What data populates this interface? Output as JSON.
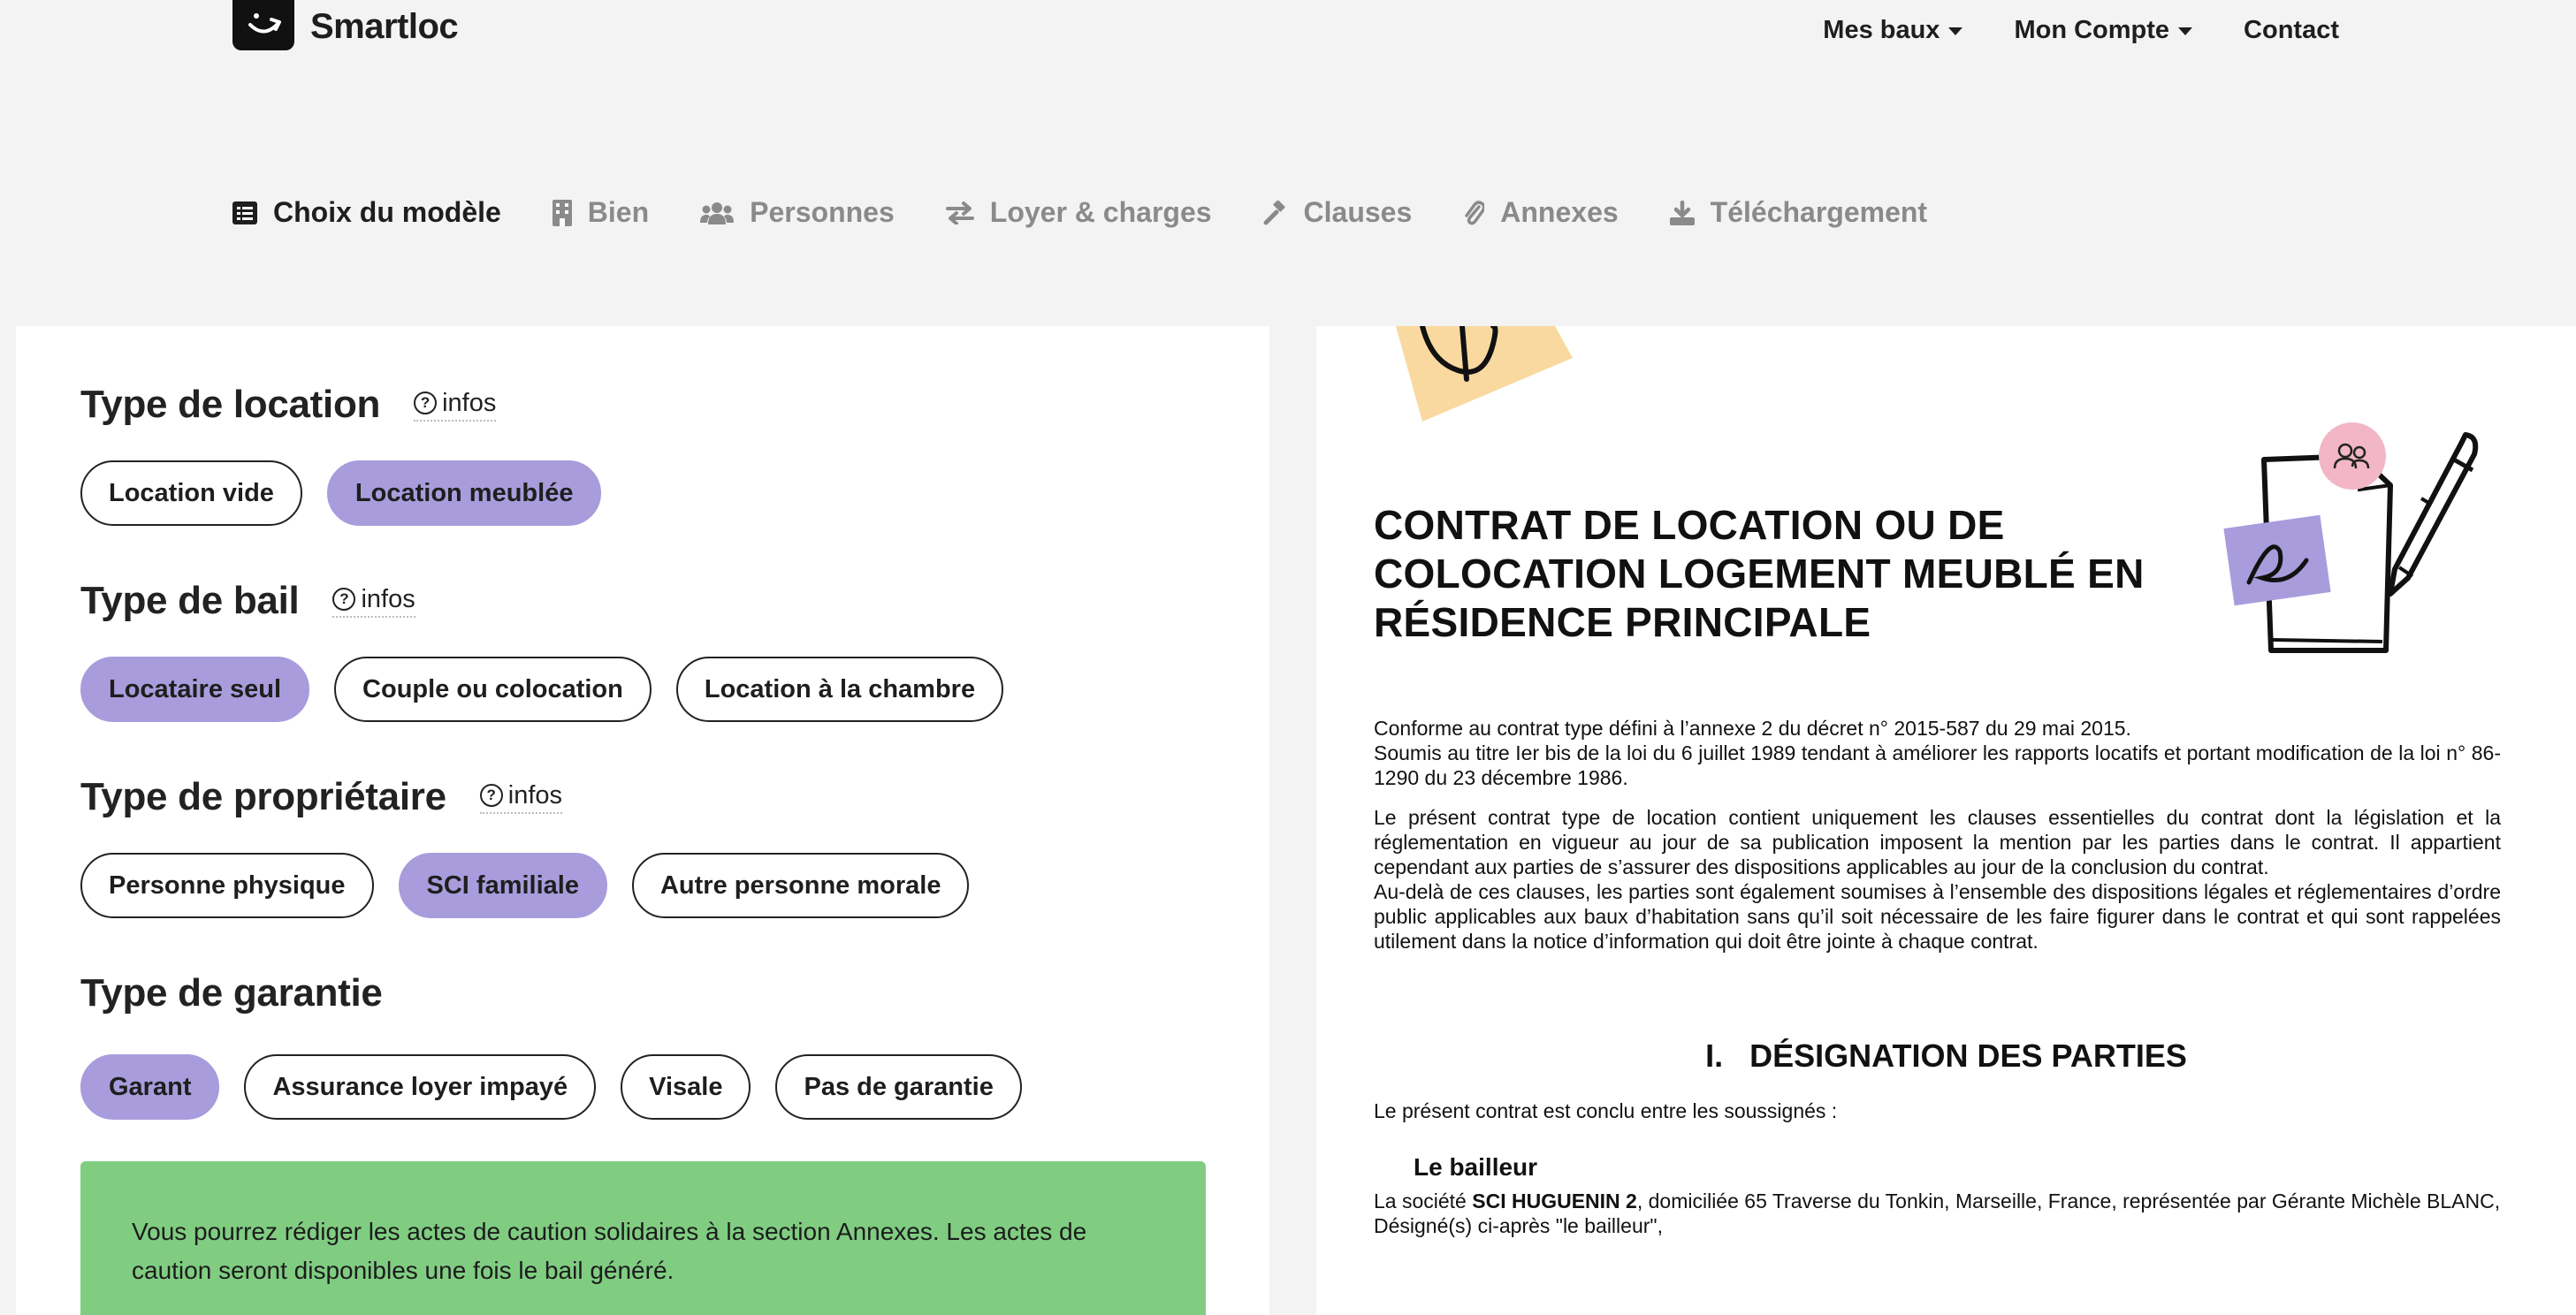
{
  "app": {
    "name": "Smartloc"
  },
  "topnav": {
    "items": [
      {
        "label": "Mes baux",
        "dropdown": true
      },
      {
        "label": "Mon Compte",
        "dropdown": true
      },
      {
        "label": "Contact",
        "dropdown": false
      }
    ]
  },
  "steps": [
    {
      "label": "Choix du modèle",
      "icon": "list-icon",
      "active": true
    },
    {
      "label": "Bien",
      "icon": "building-icon",
      "active": false
    },
    {
      "label": "Personnes",
      "icon": "users-icon",
      "active": false
    },
    {
      "label": "Loyer & charges",
      "icon": "exchange-icon",
      "active": false
    },
    {
      "label": "Clauses",
      "icon": "gavel-icon",
      "active": false
    },
    {
      "label": "Annexes",
      "icon": "paperclip-icon",
      "active": false
    },
    {
      "label": "Téléchargement",
      "icon": "download-icon",
      "active": false
    }
  ],
  "form": {
    "infos_label": "infos",
    "type_location": {
      "title": "Type de location",
      "options": [
        "Location vide",
        "Location meublée"
      ],
      "selected": "Location meublée"
    },
    "type_bail": {
      "title": "Type de bail",
      "options": [
        "Locataire seul",
        "Couple ou colocation",
        "Location à la chambre"
      ],
      "selected": "Locataire seul"
    },
    "type_proprietaire": {
      "title": "Type de propriétaire",
      "options": [
        "Personne physique",
        "SCI familiale",
        "Autre personne morale"
      ],
      "selected": "SCI familiale"
    },
    "type_garantie": {
      "title": "Type de garantie",
      "options": [
        "Garant",
        "Assurance loyer impayé",
        "Visale",
        "Pas de garantie"
      ],
      "selected": "Garant"
    },
    "notice": "Vous pourrez rédiger les actes de caution solidaires à la section Annexes. Les actes de caution seront disponibles une fois le bail généré."
  },
  "colors": {
    "selected_pill": "#a89cdc",
    "notice_bg": "#80cd82",
    "background": "#f3f3f3"
  },
  "document": {
    "title": "CONTRAT DE LOCATION OU DE COLOCATION LOGEMENT MEUBLÉ EN RÉSIDENCE PRINCIPALE",
    "p1_line1": "Conforme au contrat type défini à l’annexe 2 du décret n° 2015-587 du 29 mai 2015.",
    "p1_line2": "Soumis au titre Ier bis de la loi du 6 juillet 1989 tendant à améliorer les rapports locatifs et portant modification de la loi n° 86-1290 du 23 décembre 1986.",
    "p2": "Le présent contrat type de location contient uniquement les clauses essentielles du contrat dont la législation et la réglementation en vigueur au jour de sa publication imposent la mention par les parties dans le contrat. Il appartient cependant aux parties de s’assurer des dispositions applicables au jour de la conclusion du contrat.",
    "p3": "Au-delà de ces clauses, les parties sont également soumises à l’ensemble des dispositions légales et réglementaires d’ordre public applicables aux baux d’habitation sans qu’il soit nécessaire de les faire figurer dans le contrat et qui sont rappelées utilement dans la notice d’information qui doit être jointe à chaque contrat.",
    "section1": "I.   DÉSIGNATION DES PARTIES",
    "intro": "Le présent contrat est conclu entre les soussignés :",
    "bailleur_title": "Le bailleur",
    "bailleur_prefix": "La société ",
    "bailleur_name": "SCI HUGUENIN 2",
    "bailleur_rest": ", domiciliée 65 Traverse du Tonkin, Marseille, France, représentée par Gérante Michèle BLANC,",
    "bailleur_designe": "Désigné(s) ci-après \"le bailleur\","
  }
}
